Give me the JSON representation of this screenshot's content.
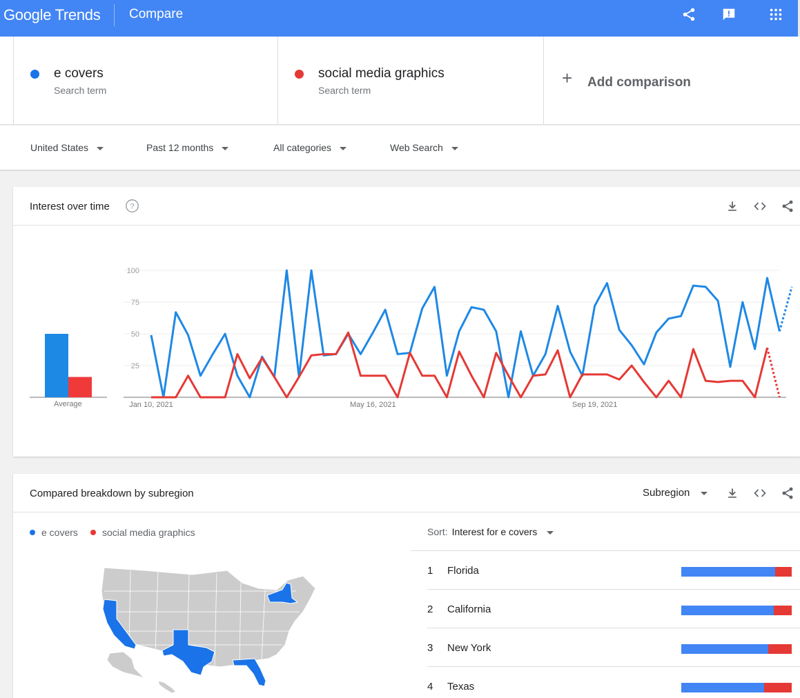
{
  "app": {
    "logo_google": "Google",
    "logo_trends": "Trends",
    "page_title": "Compare"
  },
  "colors": {
    "series1": "#1e88e5",
    "series2": "#e53935",
    "header_bg": "#4285f4",
    "map_highlight": "#1a73e8",
    "map_base": "#cccccc"
  },
  "icons": {
    "share": "share-icon",
    "feedback": "feedback-icon",
    "apps": "apps-grid-icon",
    "download": "download-icon",
    "embed": "embed-code-icon",
    "help": "help-circle-icon"
  },
  "terms": [
    {
      "name": "e covers",
      "subtitle": "Search term",
      "color": "#1e88e5"
    },
    {
      "name": "social media graphics",
      "subtitle": "Search term",
      "color": "#e53935"
    }
  ],
  "add_comparison": "Add comparison",
  "filters": {
    "region": "United States",
    "time": "Past 12 months",
    "category": "All categories",
    "search_type": "Web Search"
  },
  "interest_card": {
    "title": "Interest over time",
    "average_label": "Average"
  },
  "chart_data": {
    "type": "line",
    "title": "Interest over time",
    "ylim": [
      0,
      100
    ],
    "y_ticks": [
      25,
      50,
      75,
      100
    ],
    "x_tick_labels": [
      "Jan 10, 2021",
      "May 16, 2021",
      "Sep 19, 2021"
    ],
    "x_tick_weeks": [
      0,
      18,
      36
    ],
    "weeks_per_point": 1,
    "partial_last_point": true,
    "average": {
      "e covers": 50,
      "social media graphics": 16
    },
    "series": [
      {
        "name": "e covers",
        "color": "#1e88e5",
        "values": [
          49,
          0,
          67,
          49,
          17,
          34,
          50,
          17,
          0,
          32,
          16,
          100,
          16,
          100,
          33,
          34,
          50,
          34,
          51,
          69,
          34,
          35,
          70,
          87,
          17,
          52,
          71,
          69,
          52,
          0,
          52,
          17,
          34,
          72,
          36,
          17,
          72,
          90,
          53,
          41,
          26,
          51,
          62,
          64,
          88,
          87,
          76,
          24,
          75,
          38,
          94,
          52,
          87
        ]
      },
      {
        "name": "social media graphics",
        "color": "#e53935",
        "values": [
          0,
          0,
          0,
          17,
          0,
          0,
          0,
          34,
          15,
          31,
          16,
          0,
          16,
          33,
          34,
          34,
          51,
          17,
          17,
          17,
          0,
          35,
          17,
          17,
          0,
          36,
          17,
          0,
          35,
          17,
          0,
          17,
          18,
          37,
          0,
          18,
          18,
          18,
          14,
          25,
          12,
          0,
          13,
          0,
          38,
          13,
          12,
          13,
          13,
          0,
          39,
          0
        ]
      }
    ]
  },
  "breakdown_card": {
    "title": "Compared breakdown by subregion",
    "view_selector": "Subregion",
    "legend": [
      "e covers",
      "social media graphics"
    ],
    "sort_label": "Sort:",
    "sort_value": "Interest for e covers",
    "regions": [
      {
        "rank": "1",
        "name": "Florida",
        "share1": 0.85
      },
      {
        "rank": "2",
        "name": "California",
        "share1": 0.84
      },
      {
        "rank": "3",
        "name": "New York",
        "share1": 0.79
      },
      {
        "rank": "4",
        "name": "Texas",
        "share1": 0.75
      }
    ]
  }
}
